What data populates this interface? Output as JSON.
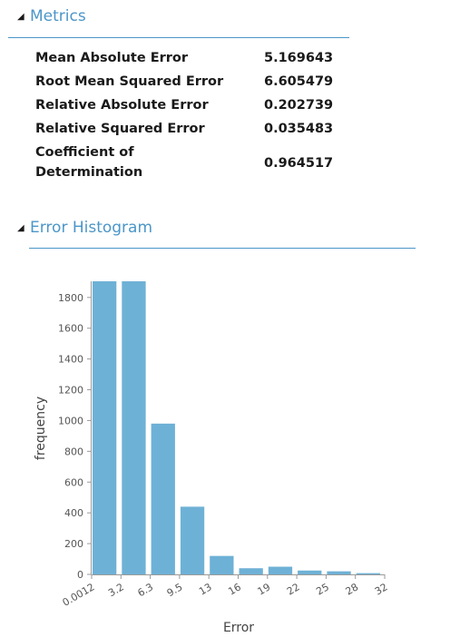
{
  "metrics": {
    "title": "Metrics",
    "rows": [
      {
        "label": "Mean Absolute Error",
        "value": "5.169643"
      },
      {
        "label": "Root Mean Squared Error",
        "value": "6.605479"
      },
      {
        "label": "Relative Absolute Error",
        "value": "0.202739"
      },
      {
        "label": "Relative Squared Error",
        "value": "0.035483"
      },
      {
        "label_line1": "Coefficient of",
        "label_line2": "Determination",
        "value": "0.964517"
      }
    ]
  },
  "histogram": {
    "title": "Error Histogram"
  },
  "colors": {
    "accent": "#4b96c8",
    "bar": "#6eb1d6",
    "axis": "#9a9a9a",
    "tick_text": "#555555"
  },
  "chart_data": {
    "type": "bar",
    "xlabel": "Error",
    "ylabel": "frequency",
    "categories": [
      "0.0012",
      "3.2",
      "6.3",
      "9.5",
      "13",
      "16",
      "19",
      "22",
      "25",
      "28"
    ],
    "values": [
      1905,
      1905,
      980,
      440,
      120,
      40,
      50,
      25,
      20,
      8
    ],
    "x_tick_labels": [
      "0.0012",
      "3.2",
      "6.3",
      "9.5",
      "13",
      "16",
      "19",
      "22",
      "25",
      "28",
      "32"
    ],
    "y_ticks": [
      0,
      200,
      400,
      600,
      800,
      1000,
      1200,
      1400,
      1600,
      1800
    ],
    "ylim": [
      0,
      1905
    ],
    "grid": false
  }
}
